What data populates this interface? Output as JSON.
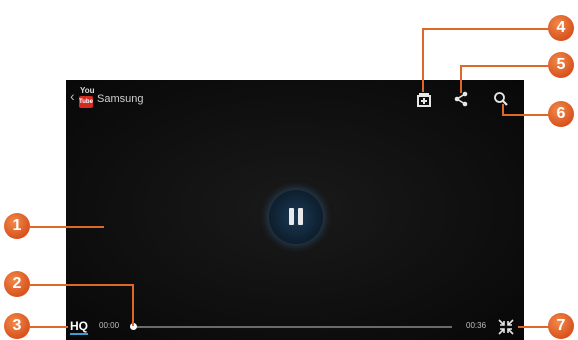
{
  "video": {
    "back_glyph": "‹",
    "logo_you": "You",
    "logo_tube": "Tube",
    "channel": "Samsung",
    "elapsed": "00:00",
    "duration": "00:36",
    "quality_label": "HQ",
    "progress": 0.0,
    "icons": {
      "add_playlist": "add-to-playlist-icon",
      "share": "share-icon",
      "search": "search-icon",
      "pause": "pause-icon",
      "collapse": "exit-fullscreen-icon"
    }
  },
  "callouts": [
    "1",
    "2",
    "3",
    "4",
    "5",
    "6",
    "7"
  ],
  "colors": {
    "callout": "#e0672a",
    "accent": "#3b9fd6",
    "background": "#0d0d0d"
  }
}
